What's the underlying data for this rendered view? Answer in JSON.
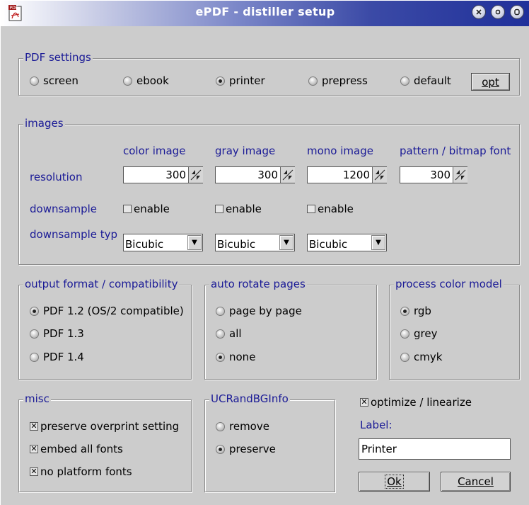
{
  "window": {
    "title": "ePDF - distiller setup",
    "icon": "pdf-document-icon",
    "controls": [
      "close-icon",
      "minimize-icon",
      "maximize-icon"
    ]
  },
  "pdf_settings": {
    "legend": "PDF settings",
    "options": [
      "screen",
      "ebook",
      "printer",
      "prepress",
      "default"
    ],
    "selected": "printer",
    "opt_button": "opt"
  },
  "images": {
    "legend": "images",
    "columns": [
      "color image",
      "gray image",
      "mono image",
      "pattern / bitmap font"
    ],
    "resolution_label": "resolution",
    "resolution_values": [
      "300",
      "300",
      "1200",
      "300"
    ],
    "downsample_label": "downsample",
    "downsample_checks": [
      "enable",
      "enable",
      "enable"
    ],
    "downsample_checked": [
      false,
      false,
      false
    ],
    "downsample_typ_label": "downsample typ",
    "downsample_types": [
      "Bicubic",
      "Bicubic",
      "Bicubic"
    ]
  },
  "output_format": {
    "legend": "output format / compatibility",
    "options": [
      "PDF 1.2 (OS/2 compatible)",
      "PDF 1.3",
      "PDF 1.4"
    ],
    "selected": "PDF 1.2 (OS/2 compatible)"
  },
  "auto_rotate": {
    "legend": "auto rotate pages",
    "options": [
      "page by page",
      "all",
      "none"
    ],
    "selected": "none"
  },
  "color_model": {
    "legend": "process color model",
    "options": [
      "rgb",
      "grey",
      "cmyk"
    ],
    "selected": "rgb"
  },
  "misc": {
    "legend": "misc",
    "checks": [
      "preserve overprint setting",
      "embed all fonts",
      "no platform fonts"
    ],
    "checked": [
      true,
      true,
      true
    ]
  },
  "ucr": {
    "legend": "UCRandBGInfo",
    "options": [
      "remove",
      "preserve"
    ],
    "selected": "preserve"
  },
  "optimize": {
    "label": "optimize / linearize",
    "checked": true
  },
  "label_field": {
    "label": "Label:",
    "value": "Printer"
  },
  "buttons": {
    "ok": "Ok",
    "cancel": "Cancel"
  },
  "colors": {
    "title_start": "#ffffff",
    "title_end": "#20309a",
    "legend_text": "#1a1a96",
    "background": "#cccccc"
  }
}
